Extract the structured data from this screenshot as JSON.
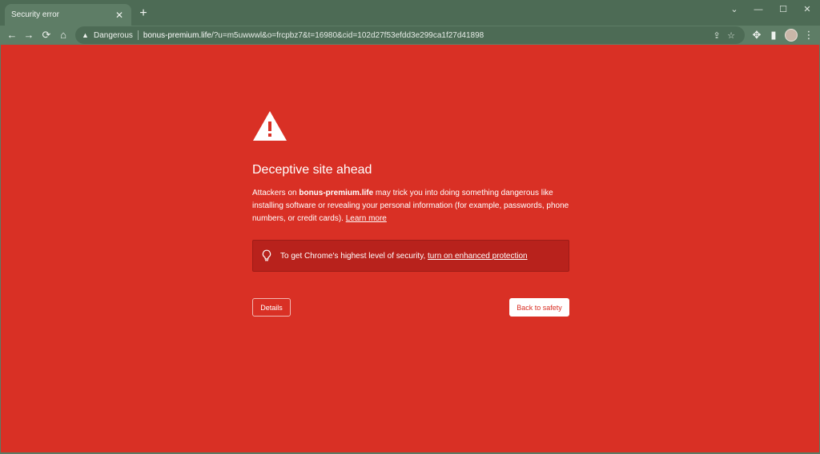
{
  "tab": {
    "title": "Security error",
    "close": "✕",
    "new_tab": "+"
  },
  "window_controls": {
    "tab_search": "⌄",
    "minimize": "—",
    "maximize": "☐",
    "close": "✕"
  },
  "toolbar": {
    "back": "←",
    "forward": "→",
    "reload": "⟳",
    "home": "⌂",
    "security_label": "Dangerous",
    "url_host": "bonus-premium.life",
    "url_path": "/?u=m5uwwwl&o=frcpbz7&t=16980&cid=102d27f53efdd3e299ca1f27d41898",
    "share": "⇪",
    "bookmark": "☆",
    "extensions": "✥",
    "side_panel": "▮",
    "menu": "⋮"
  },
  "interstitial": {
    "heading": "Deceptive site ahead",
    "desc_prefix": "Attackers on ",
    "desc_host": "bonus-premium.life",
    "desc_suffix": " may trick you into doing something dangerous like installing software or revealing your personal information (for example, passwords, phone numbers, or credit cards). ",
    "learn_more": "Learn more",
    "promo_text": "To get Chrome's highest level of security, ",
    "promo_link": "turn on enhanced protection",
    "details_button": "Details",
    "safety_button": "Back to safety"
  },
  "colors": {
    "danger_bg": "#d93025",
    "frame": "#5e7d66"
  }
}
